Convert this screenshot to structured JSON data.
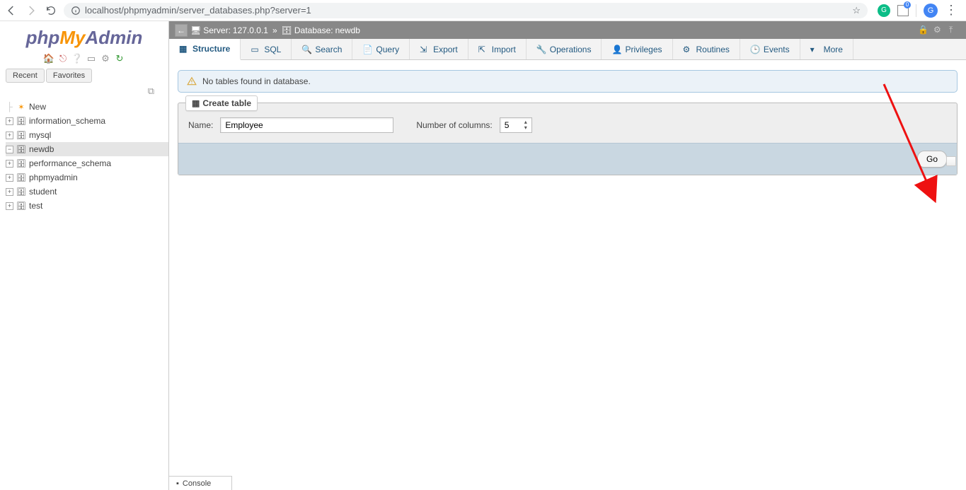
{
  "browser": {
    "url": "localhost/phpmyadmin/server_databases.php?server=1",
    "avatar_letter": "G"
  },
  "logo": {
    "p1": "php",
    "p2": "My",
    "p3": "Admin"
  },
  "sidebar": {
    "tabs": {
      "recent": "Recent",
      "favorites": "Favorites"
    },
    "new_label": "New",
    "dbs": [
      "information_schema",
      "mysql",
      "newdb",
      "performance_schema",
      "phpmyadmin",
      "student",
      "test"
    ],
    "selected_index": 2
  },
  "breadcrumb": {
    "server_label": "Server:",
    "server_value": "127.0.0.1",
    "db_label": "Database:",
    "db_value": "newdb"
  },
  "tabs": [
    {
      "label": "Structure",
      "icon": "structure"
    },
    {
      "label": "SQL",
      "icon": "sql"
    },
    {
      "label": "Search",
      "icon": "search"
    },
    {
      "label": "Query",
      "icon": "query"
    },
    {
      "label": "Export",
      "icon": "export"
    },
    {
      "label": "Import",
      "icon": "import"
    },
    {
      "label": "Operations",
      "icon": "operations"
    },
    {
      "label": "Privileges",
      "icon": "privileges"
    },
    {
      "label": "Routines",
      "icon": "routines"
    },
    {
      "label": "Events",
      "icon": "events"
    },
    {
      "label": "More",
      "icon": "more"
    }
  ],
  "active_tab_index": 0,
  "alert_text": "No tables found in database.",
  "legend": "Create table",
  "form": {
    "name_label": "Name:",
    "name_value": "Employee",
    "cols_label": "Number of columns:",
    "cols_value": "5",
    "go_label": "Go"
  },
  "console_label": "Console"
}
